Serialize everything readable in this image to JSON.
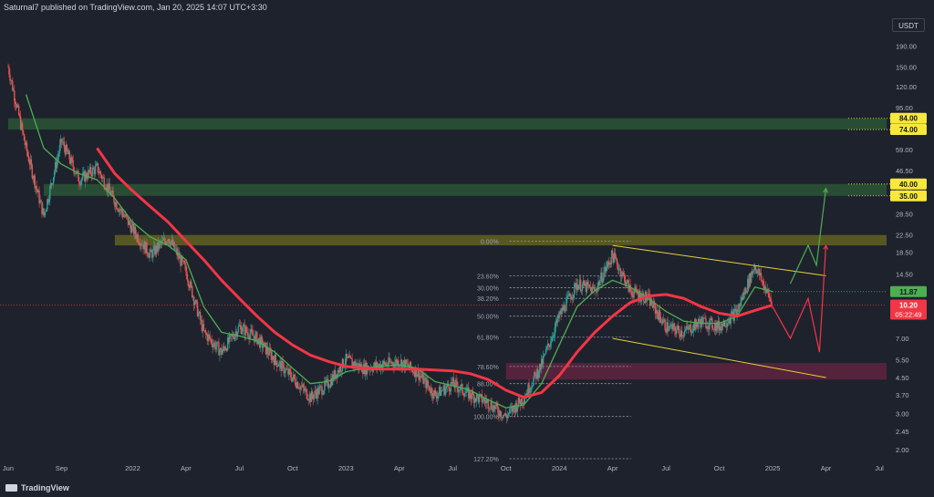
{
  "header": {
    "published": "Saturnal7 published on TradingView.com, Jan 20, 2025 14:07 UTC+3:30"
  },
  "footer": {
    "brand": "TradingView"
  },
  "price_axis": {
    "currency": "USDT"
  },
  "colors": {
    "background": "#1e222d",
    "up_candle": "#26a69a",
    "down_candle": "#ef5350",
    "ma_fast": "#4caf50",
    "ma_slow": "#f23645",
    "zone_green": "#2e5c37",
    "zone_yellow": "#6b6a1f",
    "zone_magenta": "#6b2342",
    "channel": "#e6cf3c",
    "projection_up": "#4caf50",
    "projection_down": "#f23645",
    "price_tag": "#f7e83a",
    "current_fast_tag": "#4caf50",
    "current_price_tag": "#f23645"
  },
  "chart_data": {
    "type": "candlestick",
    "scale": "log",
    "ylim": [
      1.8,
      260
    ],
    "xlim": [
      "2021-06",
      "2025-07"
    ],
    "y_ticks": [
      190.0,
      150.0,
      120.0,
      95.0,
      74.0,
      59.0,
      46.5,
      36.5,
      28.5,
      22.5,
      18.5,
      14.5,
      11.87,
      10.2,
      7.0,
      5.5,
      4.5,
      3.7,
      3.0,
      2.45,
      2.0
    ],
    "y_tick_labels": [
      "190.00",
      "150.00",
      "120.00",
      "95.00",
      "74.00",
      "59.00",
      "46.50",
      "36.50",
      "28.50",
      "22.50",
      "18.50",
      "14.50",
      "11.87",
      "10.20",
      "7.00",
      "5.50",
      "4.50",
      "3.70",
      "3.00",
      "2.45",
      "2.00"
    ],
    "x_ticks": [
      {
        "date": "2021-06",
        "label": "Jun"
      },
      {
        "date": "2021-09",
        "label": "Sep"
      },
      {
        "date": "2022-01",
        "label": "2022"
      },
      {
        "date": "2022-04",
        "label": "Apr"
      },
      {
        "date": "2022-07",
        "label": "Jul"
      },
      {
        "date": "2022-10",
        "label": "Oct"
      },
      {
        "date": "2023-01",
        "label": "2023"
      },
      {
        "date": "2023-04",
        "label": "Apr"
      },
      {
        "date": "2023-07",
        "label": "Jul"
      },
      {
        "date": "2023-10",
        "label": "Oct"
      },
      {
        "date": "2024-01",
        "label": "2024"
      },
      {
        "date": "2024-04",
        "label": "Apr"
      },
      {
        "date": "2024-07",
        "label": "Jul"
      },
      {
        "date": "2024-10",
        "label": "Oct"
      },
      {
        "date": "2025-01",
        "label": "2025"
      },
      {
        "date": "2025-04",
        "label": "Apr"
      },
      {
        "date": "2025-07",
        "label": "Jul"
      }
    ],
    "price_path": [
      [
        "2021-06",
        150
      ],
      [
        "2021-07",
        60
      ],
      [
        "2021-08",
        28
      ],
      [
        "2021-09",
        65
      ],
      [
        "2021-10",
        42
      ],
      [
        "2021-11",
        48
      ],
      [
        "2021-12",
        33
      ],
      [
        "2022-01",
        24
      ],
      [
        "2022-02",
        18
      ],
      [
        "2022-03",
        22
      ],
      [
        "2022-04",
        15
      ],
      [
        "2022-05",
        7.5
      ],
      [
        "2022-06",
        6
      ],
      [
        "2022-07",
        8
      ],
      [
        "2022-08",
        7
      ],
      [
        "2022-09",
        5.5
      ],
      [
        "2022-10",
        4.5
      ],
      [
        "2022-11",
        3.6
      ],
      [
        "2022-12",
        4.2
      ],
      [
        "2023-01",
        5.5
      ],
      [
        "2023-02",
        5
      ],
      [
        "2023-03",
        5.2
      ],
      [
        "2023-04",
        5.4
      ],
      [
        "2023-05",
        4.8
      ],
      [
        "2023-06",
        3.7
      ],
      [
        "2023-07",
        4.2
      ],
      [
        "2023-08",
        3.7
      ],
      [
        "2023-09",
        3.4
      ],
      [
        "2023-10",
        2.9
      ],
      [
        "2023-11",
        3.6
      ],
      [
        "2023-12",
        5.2
      ],
      [
        "2024-01",
        9
      ],
      [
        "2024-02",
        13
      ],
      [
        "2024-03",
        12
      ],
      [
        "2024-04",
        18
      ],
      [
        "2024-05",
        12
      ],
      [
        "2024-06",
        11
      ],
      [
        "2024-07",
        8
      ],
      [
        "2024-08",
        7.5
      ],
      [
        "2024-09",
        8.5
      ],
      [
        "2024-10",
        8
      ],
      [
        "2024-11",
        9.5
      ],
      [
        "2024-12",
        16
      ],
      [
        "2025-01",
        10.2
      ]
    ],
    "series": [
      {
        "type": "line",
        "values": [
          [
            "2021-07",
            110
          ],
          [
            "2021-08",
            60
          ],
          [
            "2021-09",
            50
          ],
          [
            "2021-10",
            45
          ],
          [
            "2021-11",
            42
          ],
          [
            "2021-12",
            34
          ],
          [
            "2022-01",
            26
          ],
          [
            "2022-02",
            22
          ],
          [
            "2022-03",
            20
          ],
          [
            "2022-04",
            17
          ],
          [
            "2022-05",
            10
          ],
          [
            "2022-06",
            7.5
          ],
          [
            "2022-07",
            7.2
          ],
          [
            "2022-08",
            6.8
          ],
          [
            "2022-09",
            6
          ],
          [
            "2022-10",
            5
          ],
          [
            "2022-11",
            4.2
          ],
          [
            "2022-12",
            4.3
          ],
          [
            "2023-01",
            4.8
          ],
          [
            "2023-02",
            5
          ],
          [
            "2023-03",
            5.1
          ],
          [
            "2023-04",
            5.2
          ],
          [
            "2023-05",
            5
          ],
          [
            "2023-06",
            4.3
          ],
          [
            "2023-07",
            4.1
          ],
          [
            "2023-08",
            3.9
          ],
          [
            "2023-09",
            3.5
          ],
          [
            "2023-10",
            3.2
          ],
          [
            "2023-11",
            3.3
          ],
          [
            "2023-12",
            4.2
          ],
          [
            "2024-01",
            6.5
          ],
          [
            "2024-02",
            10
          ],
          [
            "2024-03",
            12
          ],
          [
            "2024-04",
            13.5
          ],
          [
            "2024-05",
            12.5
          ],
          [
            "2024-06",
            11
          ],
          [
            "2024-07",
            9.5
          ],
          [
            "2024-08",
            8.5
          ],
          [
            "2024-09",
            8.3
          ],
          [
            "2024-10",
            8.3
          ],
          [
            "2024-11",
            9
          ],
          [
            "2024-12",
            12.5
          ],
          [
            "2025-01",
            11.87
          ]
        ]
      },
      {
        "type": "line",
        "values": [
          [
            "2021-11",
            60
          ],
          [
            "2021-12",
            45
          ],
          [
            "2022-01",
            37
          ],
          [
            "2022-02",
            31
          ],
          [
            "2022-03",
            26
          ],
          [
            "2022-04",
            21
          ],
          [
            "2022-05",
            17
          ],
          [
            "2022-06",
            13.5
          ],
          [
            "2022-07",
            11
          ],
          [
            "2022-08",
            9
          ],
          [
            "2022-09",
            7.5
          ],
          [
            "2022-10",
            6.5
          ],
          [
            "2022-11",
            5.8
          ],
          [
            "2022-12",
            5.4
          ],
          [
            "2023-01",
            5.1
          ],
          [
            "2023-02",
            5
          ],
          [
            "2023-03",
            4.95
          ],
          [
            "2023-04",
            4.95
          ],
          [
            "2023-05",
            4.95
          ],
          [
            "2023-06",
            4.9
          ],
          [
            "2023-07",
            4.85
          ],
          [
            "2023-08",
            4.7
          ],
          [
            "2023-09",
            4.4
          ],
          [
            "2023-10",
            3.9
          ],
          [
            "2023-11",
            3.6
          ],
          [
            "2023-12",
            3.8
          ],
          [
            "2024-01",
            4.6
          ],
          [
            "2024-02",
            6
          ],
          [
            "2024-03",
            7.5
          ],
          [
            "2024-04",
            9
          ],
          [
            "2024-05",
            10.5
          ],
          [
            "2024-06",
            11.3
          ],
          [
            "2024-07",
            11.5
          ],
          [
            "2024-08",
            11
          ],
          [
            "2024-09",
            10
          ],
          [
            "2024-10",
            9.3
          ],
          [
            "2024-11",
            9
          ],
          [
            "2024-12",
            9.6
          ],
          [
            "2025-01",
            10.2
          ]
        ]
      }
    ],
    "zones": [
      {
        "color": "green",
        "from": 74,
        "to": 84,
        "start": "2021-06"
      },
      {
        "color": "green",
        "from": 35,
        "to": 40,
        "start": "2021-08"
      },
      {
        "color": "yellow",
        "from": 20,
        "to": 22.5,
        "start": "2021-12"
      },
      {
        "color": "magenta",
        "from": 4.4,
        "to": 5.3,
        "start": "2023-10"
      }
    ],
    "fibonacci": [
      {
        "label": "0.00%",
        "value": 21
      },
      {
        "label": "23.60%",
        "value": 14.2
      },
      {
        "label": "30.00%",
        "value": 12.4
      },
      {
        "label": "38.20%",
        "value": 11
      },
      {
        "label": "50.00%",
        "value": 9
      },
      {
        "label": "61.80%",
        "value": 7.1
      },
      {
        "label": "78.60%",
        "value": 5.1
      },
      {
        "label": "88.00%",
        "value": 4.2
      },
      {
        "label": "100.00%",
        "value": 2.9
      },
      {
        "label": "127.20%",
        "value": 1.8
      }
    ],
    "channel": [
      {
        "from": [
          "2024-04",
          20
        ],
        "to": [
          "2025-04",
          14.2
        ]
      },
      {
        "from": [
          "2024-04",
          7
        ],
        "to": [
          "2025-04",
          4.5
        ]
      }
    ],
    "projections": [
      {
        "color": "green",
        "points": [
          [
            "2025-02",
            13
          ],
          [
            "2025-03",
            20
          ],
          [
            "2025-03-15",
            16
          ],
          [
            "2025-04",
            38
          ]
        ],
        "end_value": 38
      },
      {
        "color": "red",
        "points": [
          [
            "2025-01",
            10
          ],
          [
            "2025-02",
            7
          ],
          [
            "2025-03",
            11
          ],
          [
            "2025-03-20",
            6
          ],
          [
            "2025-04",
            20
          ]
        ],
        "end_value": 20
      }
    ],
    "price_tags": [
      {
        "label": "84.00",
        "value": 84
      },
      {
        "label": "74.00",
        "value": 74
      },
      {
        "label": "40.00",
        "value": 40
      },
      {
        "label": "35.00",
        "value": 35
      }
    ],
    "current": {
      "fast_ma": {
        "label": "11.87",
        "value": 11.87
      },
      "price": {
        "label": "10.20",
        "value": 10.2,
        "countdown": "05:22:49"
      }
    }
  }
}
